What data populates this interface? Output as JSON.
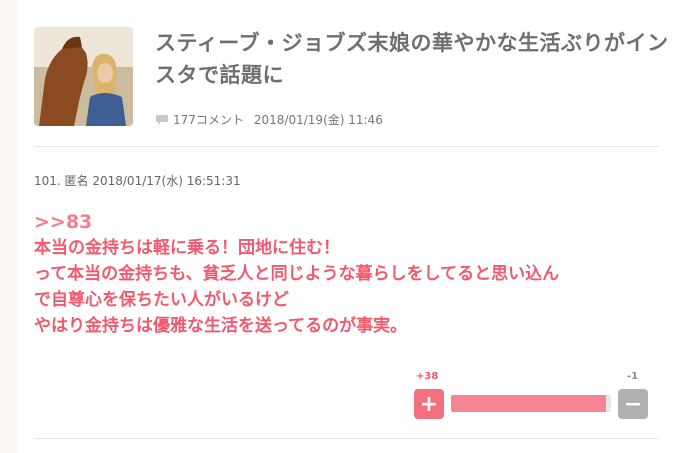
{
  "article": {
    "title": "スティーブ・ジョブズ末娘の華やかな生活ぶりがインスタで話題に",
    "comment_count": "177コメント",
    "date": "2018/01/19(金) 11:46"
  },
  "comment": {
    "header": "101. 匿名 2018/01/17(水) 16:51:31",
    "anchor": ">>83",
    "lines": [
      "本当の金持ちは軽に乗る！団地に住む！",
      "って本当の金持ちも、貧乏人と同じような暮らしをしてると思い込ん",
      "で自尊心を保ちたい人がいるけど",
      "やはり金持ちは優雅な生活を送ってるのが事実。"
    ]
  },
  "vote": {
    "plus_count": "+38",
    "minus_count": "-1",
    "plus_label": "+",
    "minus_label": "−",
    "plus_ratio": 0.97
  },
  "colors": {
    "accent": "#f05a6e",
    "bar_fill": "#f58593",
    "minus_button": "#b0b0b0"
  },
  "icons": {
    "comment": "comment-bubble-icon"
  }
}
